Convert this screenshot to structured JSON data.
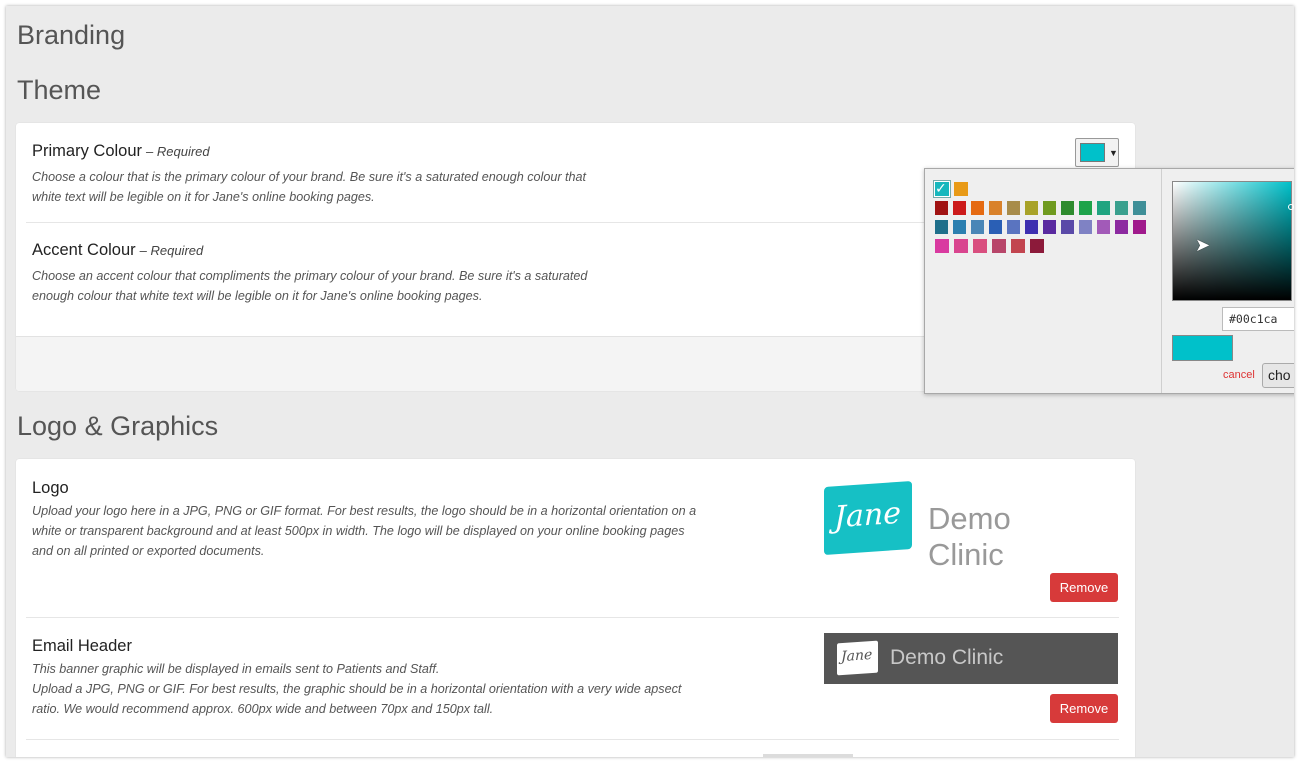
{
  "page": {
    "title": "Branding"
  },
  "theme": {
    "heading": "Theme",
    "primary": {
      "title": "Primary Colour",
      "required": "– Required",
      "desc1": "Choose a colour that is the primary colour of your brand. Be sure it's a saturated enough colour that",
      "desc2": "white text will be legible on it for Jane's online booking pages.",
      "swatch_color": "#00c1ca"
    },
    "accent": {
      "title": "Accent Colour",
      "required": "– Required",
      "desc1": "Choose an accent colour that compliments the primary colour of your brand. Be sure it's a saturated",
      "desc2": "enough colour that white text will be legible on it for Jane's online booking pages."
    }
  },
  "picker": {
    "palette": [
      [
        "#17b7bd",
        "#e89a17"
      ],
      [
        "#a01212",
        "#cc1a1a",
        "#e56a12",
        "#d9822b",
        "#a88c4a",
        "#a8a228",
        "#6f9a1f",
        "#2e8b2e",
        "#1ea34a",
        "#1fa480",
        "#3aa08e",
        "#3f8f98"
      ],
      [
        "#1f6f8b",
        "#2b7fb0",
        "#4a86b7",
        "#2a5fb5",
        "#5a74c0",
        "#3d2fb0",
        "#5a2aa0",
        "#5a4aa8",
        "#7f82c4",
        "#a25ab8",
        "#8c2aa0",
        "#a01a8c"
      ],
      [
        "#d93aa0",
        "#d9458f",
        "#d94f7f",
        "#b8466a",
        "#c2454f",
        "#8c1a3a"
      ]
    ],
    "selected_color": "#00c1ca",
    "hex_value": "#00c1ca",
    "cancel_label": "cancel",
    "choose_label": "cho"
  },
  "logo_graphics": {
    "heading": "Logo & Graphics",
    "logo": {
      "title": "Logo",
      "desc1": "Upload your logo here in a JPG, PNG or GIF format. For best results, the logo should be in a horizontal orientation on a",
      "desc2": "white or transparent background and at least 500px in width. The logo will be displayed on your online booking pages",
      "desc3": "and on all printed or exported documents.",
      "mark_text": "Jane",
      "brand_text": "Demo Clinic",
      "remove_label": "Remove"
    },
    "email_header": {
      "title": "Email Header",
      "desc1": "This banner graphic will be displayed in emails sent to Patients and Staff.",
      "desc2": "Upload a JPG, PNG or GIF. For best results, the graphic should be in a horizontal orientation with a very wide apsect",
      "desc3": "ratio. We would recommend approx. 600px wide and between 70px and 150px tall.",
      "mark_text": "Jane",
      "brand_text": "Demo Clinic",
      "remove_label": "Remove"
    }
  }
}
